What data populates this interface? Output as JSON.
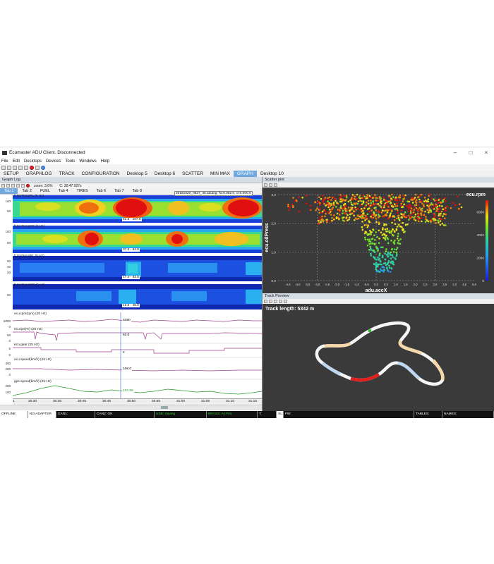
{
  "window": {
    "title": "Ecumaster ADU Client. Disconnected"
  },
  "menu": [
    "File",
    "Edit",
    "Desktops",
    "Devices",
    "Tools",
    "Windows",
    "Help"
  ],
  "desktop_tabs": [
    "SETUP",
    "GRAPHLOG",
    "TRACK",
    "CONFIGURATION",
    "Desktop 5",
    "Desktop 6",
    "SCATTER",
    "MIN MAX",
    "GRAPH",
    "Desktop 10"
  ],
  "active_desktop_tab": "GRAPH",
  "graphlog": {
    "panel_title": "Graph Log",
    "zoom": "zoom: 3,6%",
    "cursor_time": "C: 30:47.927s",
    "tabs": [
      "Tab 1",
      "Tab 2",
      "FUEL",
      "Tab 4",
      "TIRES",
      "Tab 6",
      "Tab 7",
      "Tab 8"
    ],
    "active_tab": "Tab 1",
    "tooltip": "20181020_0837_46.adulog: fw:0.052.0, cl:0.000.0",
    "heatmaps": [
      {
        "name": "fr.tireTempFL (5 Hz)",
        "value": "61.5 - 107.0",
        "yticks": [
          "100",
          "50"
        ]
      },
      {
        "name": "fr.tireTempFR (5 Hz)",
        "value": "37.0 - 84.0",
        "yticks": [
          "100",
          "50"
        ]
      },
      {
        "name": "fr.tireTempRL (5 Hz)",
        "value": "17.0 - 63.0",
        "yticks": [
          "60",
          "40",
          "20"
        ]
      },
      {
        "name": "fr.tireTempRR (5 Hz)",
        "value": "13.0 - 48.0",
        "yticks": [
          "50"
        ]
      }
    ],
    "lines": [
      {
        "name": "ecu.rpm(rpm) (25 Hz)",
        "value": "5380",
        "yticks": [
          "5000",
          "0"
        ],
        "color": "#a04090"
      },
      {
        "name": "ecu.tps(%) (25 Hz)",
        "value": "63.0",
        "yticks": [
          "50",
          "0"
        ],
        "color": "#a04090"
      },
      {
        "name": "ecu.gear (25 Hz)",
        "value": "2",
        "yticks": [
          "5",
          "0"
        ],
        "color": "#a04090"
      },
      {
        "name": "ecu.speed(km/h) (25 Hz)",
        "value": "106.0",
        "yticks": [
          "400",
          "200",
          "0"
        ],
        "color": "#a04090"
      },
      {
        "name": "gps.speed(km/h) (25 Hz)",
        "value": "102.59",
        "yticks": [
          "200",
          "100"
        ],
        "color": "#2a9a2a"
      }
    ],
    "xticks": [
      "1",
      "30:30",
      "30:35",
      "30:40",
      "30:45",
      "30:50",
      "30:55",
      "31:00",
      "31:05",
      "31:10",
      "31:15"
    ]
  },
  "scatter": {
    "panel_title": "Scatter plot",
    "chart_data": {
      "type": "scatter",
      "xlabel": "adu.accX",
      "ylabel": "ecu.oilPress",
      "colorbar_label": "ecu.rpm",
      "xlim": [
        -5.0,
        5.0
      ],
      "ylim": [
        0,
        3.0
      ],
      "xticks": [
        "-4,5",
        "-4,0",
        "-3,5",
        "-3,0",
        "-2,5",
        "-2,0",
        "-1,5",
        "-1,0",
        "-0,5",
        "0,0",
        "0,5",
        "1,0",
        "1,5",
        "2,0",
        "2,5",
        "3,0",
        "3,5",
        "4,0",
        "4,5",
        "5,0"
      ],
      "yticks": [
        "0,0",
        "1,0",
        "2,0",
        "3,0"
      ],
      "colorbar_ticks": [
        "0",
        "2000",
        "4000",
        "6000"
      ],
      "color_range": [
        0,
        7000
      ]
    }
  },
  "track": {
    "panel_title": "Track Preview",
    "length_label": "Track length: 5342 m"
  },
  "status": [
    "OFFLINE",
    "NO ADAPTER",
    "CAN1:",
    "CAN2: OK",
    "USB: Saving",
    "BRASS: A (7%)",
    "T:",
    "SL:",
    "FW:",
    "TABLES:",
    "NAMES:"
  ]
}
